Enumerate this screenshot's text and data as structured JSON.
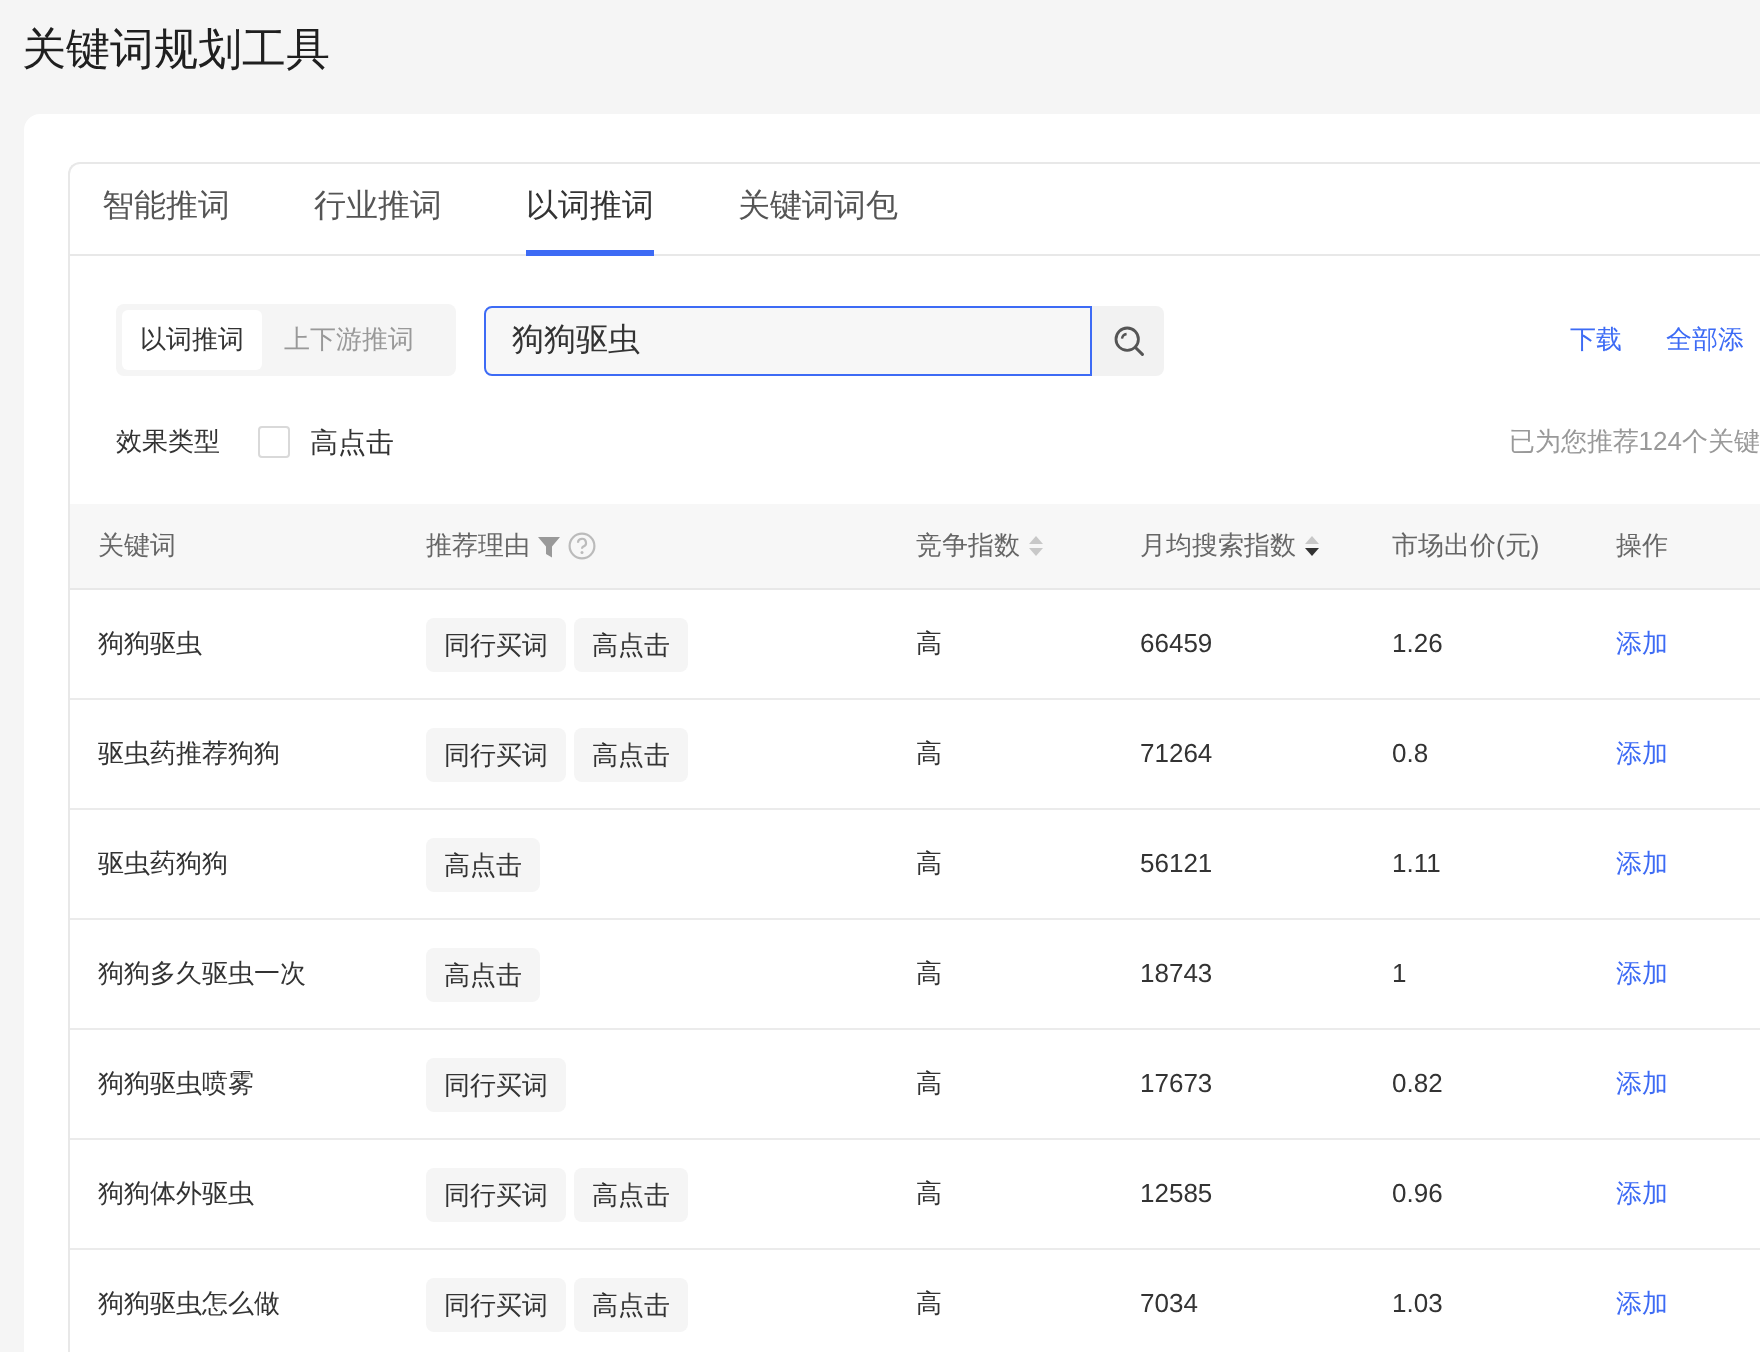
{
  "page": {
    "title": "关键词规划工具"
  },
  "tabs": [
    {
      "label": "智能推词",
      "selected": false
    },
    {
      "label": "行业推词",
      "selected": false
    },
    {
      "label": "以词推词",
      "selected": true
    },
    {
      "label": "关键词词包",
      "selected": false
    }
  ],
  "mode_switch": [
    {
      "label": "以词推词",
      "selected": true
    },
    {
      "label": "上下游推词",
      "selected": false
    }
  ],
  "search": {
    "value": "狗狗驱虫"
  },
  "actions": [
    {
      "label": "下载"
    },
    {
      "label": "全部添"
    }
  ],
  "filter": {
    "label": "效果类型",
    "options": [
      {
        "label": "高点击",
        "checked": false
      }
    ]
  },
  "summary": "已为您推荐124个关键",
  "table": {
    "columns": [
      {
        "label": "关键词"
      },
      {
        "label": "推荐理由",
        "filter_icon": true,
        "help_icon": true
      },
      {
        "label": "竞争指数",
        "sortable": true,
        "sorted_desc": false
      },
      {
        "label": "月均搜索指数",
        "sortable": true,
        "sorted_desc": true
      },
      {
        "label": "市场出价(元)"
      },
      {
        "label": "操作"
      }
    ],
    "rows": [
      {
        "keyword": "狗狗驱虫",
        "reasons": [
          "同行买词",
          "高点击"
        ],
        "competition": "高",
        "monthly_searches": "66459",
        "bid": "1.26",
        "action": "添加"
      },
      {
        "keyword": "驱虫药推荐狗狗",
        "reasons": [
          "同行买词",
          "高点击"
        ],
        "competition": "高",
        "monthly_searches": "71264",
        "bid": "0.8",
        "action": "添加"
      },
      {
        "keyword": "驱虫药狗狗",
        "reasons": [
          "高点击"
        ],
        "competition": "高",
        "monthly_searches": "56121",
        "bid": "1.11",
        "action": "添加"
      },
      {
        "keyword": "狗狗多久驱虫一次",
        "reasons": [
          "高点击"
        ],
        "competition": "高",
        "monthly_searches": "18743",
        "bid": "1",
        "action": "添加"
      },
      {
        "keyword": "狗狗驱虫喷雾",
        "reasons": [
          "同行买词"
        ],
        "competition": "高",
        "monthly_searches": "17673",
        "bid": "0.82",
        "action": "添加"
      },
      {
        "keyword": "狗狗体外驱虫",
        "reasons": [
          "同行买词",
          "高点击"
        ],
        "competition": "高",
        "monthly_searches": "12585",
        "bid": "0.96",
        "action": "添加"
      },
      {
        "keyword": "狗狗驱虫怎么做",
        "reasons": [
          "同行买词",
          "高点击"
        ],
        "competition": "高",
        "monthly_searches": "7034",
        "bid": "1.03",
        "action": "添加"
      }
    ]
  }
}
